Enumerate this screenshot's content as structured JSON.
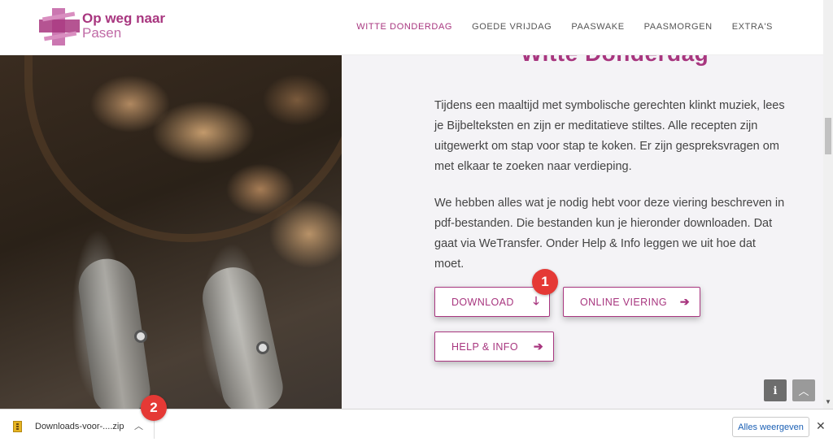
{
  "header": {
    "brand_line1": "Op weg naar",
    "brand_line2": "Pasen",
    "nav": [
      "WITTE DONDERDAG",
      "GOEDE VRIJDAG",
      "PAASWAKE",
      "PAASMORGEN",
      "EXTRA'S"
    ]
  },
  "main": {
    "title": "Witte Donderdag",
    "paragraph1": "Tijdens een maaltijd met symbolische gerechten klinkt muziek, lees je Bijbelteksten en zijn er meditatieve stiltes. Alle recepten zijn uitgewerkt om stap voor stap te koken. Er zijn gespreksvragen om met elkaar te zoeken naar verdieping.",
    "paragraph2": "We hebben alles wat je nodig hebt voor deze viering beschreven in pdf-bestanden. Die bestanden kun je hieronder downloaden. Dat gaat via WeTransfer. Onder Help & Info leggen we uit hoe dat moet.",
    "buttons": {
      "download": "DOWNLOAD",
      "online": "ONLINE VIERING",
      "help": "HELP & INFO"
    }
  },
  "annotations": {
    "badge1": "1",
    "badge2": "2"
  },
  "download_bar": {
    "filename": "Downloads-voor-....zip",
    "show_all": "Alles weergeven"
  },
  "colors": {
    "accent": "#a8367f",
    "badge": "#e53935"
  },
  "icons": [
    "logo-cross-icon",
    "arrow-down-icon",
    "arrow-right-icon",
    "info-icon",
    "chevron-up-icon",
    "zip-file-icon",
    "close-icon"
  ]
}
